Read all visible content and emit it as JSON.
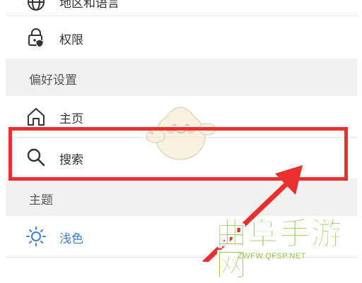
{
  "settings": {
    "items": [
      {
        "label": "地区和语言",
        "icon": "globe-icon"
      },
      {
        "label": "权限",
        "icon": "lock-shield-icon"
      }
    ],
    "section_preferences": "偏好设置",
    "preference_items": [
      {
        "label": "主页",
        "icon": "home-icon"
      },
      {
        "label": "搜索",
        "icon": "search-icon"
      }
    ],
    "section_theme": "主题",
    "theme_items": [
      {
        "label": "浅色",
        "icon": "sun-icon"
      }
    ]
  },
  "watermark": {
    "text": "曲阜手游网",
    "url": "ZWFW.QFSP.NET"
  },
  "colors": {
    "highlight": "#ea2f2f",
    "accent": "#3d7fd6",
    "watermark": "#8bc34a"
  }
}
